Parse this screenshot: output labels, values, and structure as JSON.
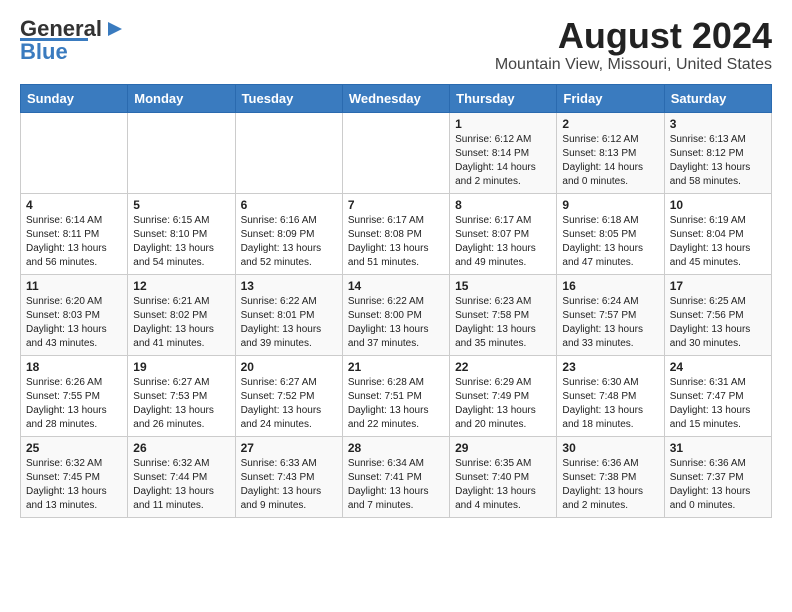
{
  "header": {
    "logo_line1": "General",
    "logo_line2": "Blue",
    "title": "August 2024",
    "subtitle": "Mountain View, Missouri, United States"
  },
  "weekdays": [
    "Sunday",
    "Monday",
    "Tuesday",
    "Wednesday",
    "Thursday",
    "Friday",
    "Saturday"
  ],
  "weeks": [
    [
      {
        "day": "",
        "info": ""
      },
      {
        "day": "",
        "info": ""
      },
      {
        "day": "",
        "info": ""
      },
      {
        "day": "",
        "info": ""
      },
      {
        "day": "1",
        "info": "Sunrise: 6:12 AM\nSunset: 8:14 PM\nDaylight: 14 hours\nand 2 minutes."
      },
      {
        "day": "2",
        "info": "Sunrise: 6:12 AM\nSunset: 8:13 PM\nDaylight: 14 hours\nand 0 minutes."
      },
      {
        "day": "3",
        "info": "Sunrise: 6:13 AM\nSunset: 8:12 PM\nDaylight: 13 hours\nand 58 minutes."
      }
    ],
    [
      {
        "day": "4",
        "info": "Sunrise: 6:14 AM\nSunset: 8:11 PM\nDaylight: 13 hours\nand 56 minutes."
      },
      {
        "day": "5",
        "info": "Sunrise: 6:15 AM\nSunset: 8:10 PM\nDaylight: 13 hours\nand 54 minutes."
      },
      {
        "day": "6",
        "info": "Sunrise: 6:16 AM\nSunset: 8:09 PM\nDaylight: 13 hours\nand 52 minutes."
      },
      {
        "day": "7",
        "info": "Sunrise: 6:17 AM\nSunset: 8:08 PM\nDaylight: 13 hours\nand 51 minutes."
      },
      {
        "day": "8",
        "info": "Sunrise: 6:17 AM\nSunset: 8:07 PM\nDaylight: 13 hours\nand 49 minutes."
      },
      {
        "day": "9",
        "info": "Sunrise: 6:18 AM\nSunset: 8:05 PM\nDaylight: 13 hours\nand 47 minutes."
      },
      {
        "day": "10",
        "info": "Sunrise: 6:19 AM\nSunset: 8:04 PM\nDaylight: 13 hours\nand 45 minutes."
      }
    ],
    [
      {
        "day": "11",
        "info": "Sunrise: 6:20 AM\nSunset: 8:03 PM\nDaylight: 13 hours\nand 43 minutes."
      },
      {
        "day": "12",
        "info": "Sunrise: 6:21 AM\nSunset: 8:02 PM\nDaylight: 13 hours\nand 41 minutes."
      },
      {
        "day": "13",
        "info": "Sunrise: 6:22 AM\nSunset: 8:01 PM\nDaylight: 13 hours\nand 39 minutes."
      },
      {
        "day": "14",
        "info": "Sunrise: 6:22 AM\nSunset: 8:00 PM\nDaylight: 13 hours\nand 37 minutes."
      },
      {
        "day": "15",
        "info": "Sunrise: 6:23 AM\nSunset: 7:58 PM\nDaylight: 13 hours\nand 35 minutes."
      },
      {
        "day": "16",
        "info": "Sunrise: 6:24 AM\nSunset: 7:57 PM\nDaylight: 13 hours\nand 33 minutes."
      },
      {
        "day": "17",
        "info": "Sunrise: 6:25 AM\nSunset: 7:56 PM\nDaylight: 13 hours\nand 30 minutes."
      }
    ],
    [
      {
        "day": "18",
        "info": "Sunrise: 6:26 AM\nSunset: 7:55 PM\nDaylight: 13 hours\nand 28 minutes."
      },
      {
        "day": "19",
        "info": "Sunrise: 6:27 AM\nSunset: 7:53 PM\nDaylight: 13 hours\nand 26 minutes."
      },
      {
        "day": "20",
        "info": "Sunrise: 6:27 AM\nSunset: 7:52 PM\nDaylight: 13 hours\nand 24 minutes."
      },
      {
        "day": "21",
        "info": "Sunrise: 6:28 AM\nSunset: 7:51 PM\nDaylight: 13 hours\nand 22 minutes."
      },
      {
        "day": "22",
        "info": "Sunrise: 6:29 AM\nSunset: 7:49 PM\nDaylight: 13 hours\nand 20 minutes."
      },
      {
        "day": "23",
        "info": "Sunrise: 6:30 AM\nSunset: 7:48 PM\nDaylight: 13 hours\nand 18 minutes."
      },
      {
        "day": "24",
        "info": "Sunrise: 6:31 AM\nSunset: 7:47 PM\nDaylight: 13 hours\nand 15 minutes."
      }
    ],
    [
      {
        "day": "25",
        "info": "Sunrise: 6:32 AM\nSunset: 7:45 PM\nDaylight: 13 hours\nand 13 minutes."
      },
      {
        "day": "26",
        "info": "Sunrise: 6:32 AM\nSunset: 7:44 PM\nDaylight: 13 hours\nand 11 minutes."
      },
      {
        "day": "27",
        "info": "Sunrise: 6:33 AM\nSunset: 7:43 PM\nDaylight: 13 hours\nand 9 minutes."
      },
      {
        "day": "28",
        "info": "Sunrise: 6:34 AM\nSunset: 7:41 PM\nDaylight: 13 hours\nand 7 minutes."
      },
      {
        "day": "29",
        "info": "Sunrise: 6:35 AM\nSunset: 7:40 PM\nDaylight: 13 hours\nand 4 minutes."
      },
      {
        "day": "30",
        "info": "Sunrise: 6:36 AM\nSunset: 7:38 PM\nDaylight: 13 hours\nand 2 minutes."
      },
      {
        "day": "31",
        "info": "Sunrise: 6:36 AM\nSunset: 7:37 PM\nDaylight: 13 hours\nand 0 minutes."
      }
    ]
  ]
}
